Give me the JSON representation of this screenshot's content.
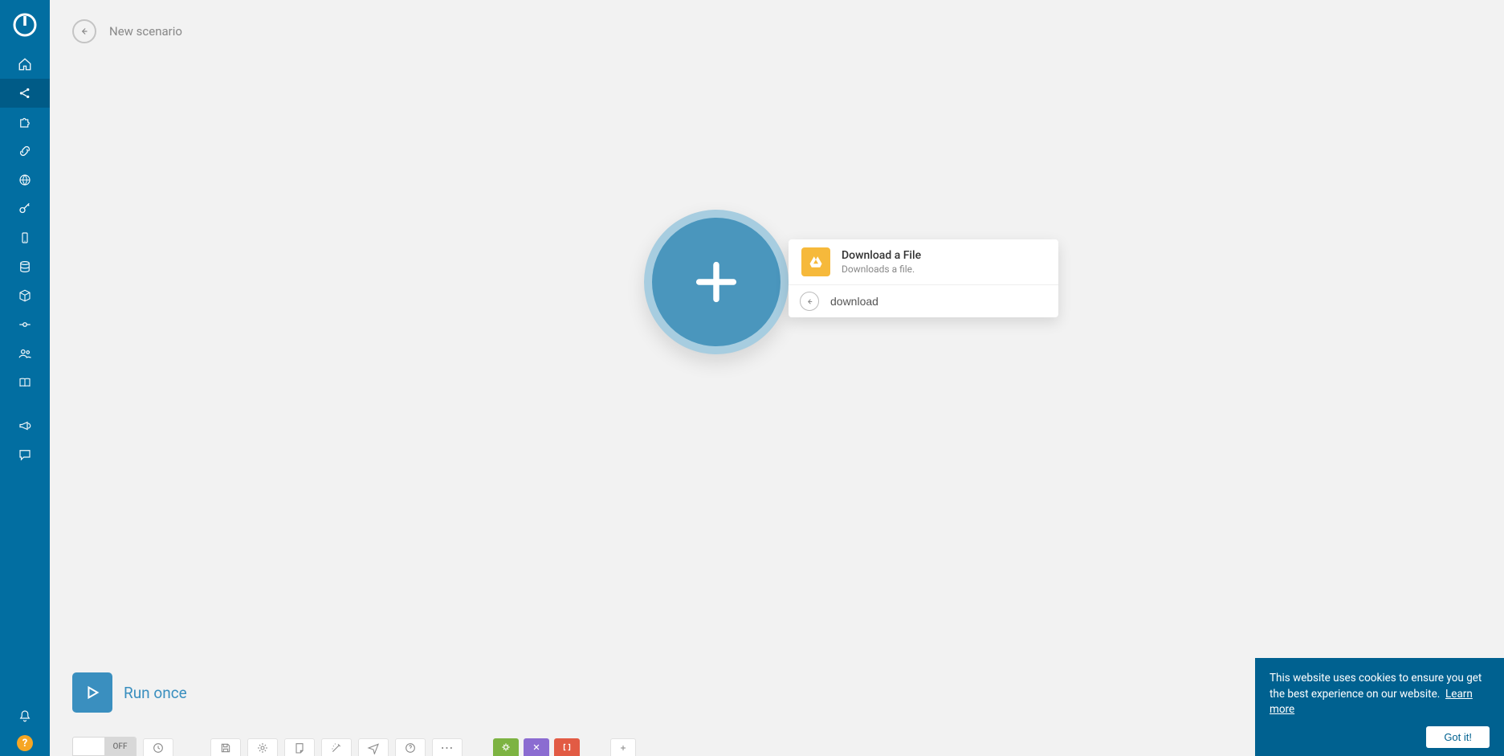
{
  "header": {
    "title": "New scenario"
  },
  "sidebar": {
    "items": [
      {
        "name": "home",
        "active": false
      },
      {
        "name": "share",
        "active": true
      },
      {
        "name": "puzzle",
        "active": false
      },
      {
        "name": "link",
        "active": false
      },
      {
        "name": "globe",
        "active": false
      },
      {
        "name": "key",
        "active": false
      },
      {
        "name": "mobile",
        "active": false
      },
      {
        "name": "database",
        "active": false
      },
      {
        "name": "cube",
        "active": false
      },
      {
        "name": "node",
        "active": false
      },
      {
        "name": "users",
        "active": false
      },
      {
        "name": "book",
        "active": false
      },
      {
        "name": "megaphone",
        "active": false
      },
      {
        "name": "chat",
        "active": false
      }
    ],
    "bottom": {
      "bell": "notifications",
      "help": "?"
    }
  },
  "dropdown": {
    "item": {
      "title": "Download a File",
      "subtitle": "Downloads a file.",
      "icon": "google-drive"
    },
    "search_value": "download"
  },
  "run": {
    "label": "Run once"
  },
  "bottombar": {
    "toggle_label": "OFF",
    "tools": [
      "clock",
      "save",
      "settings",
      "note",
      "wand",
      "plane",
      "help",
      "more"
    ],
    "favorites": [
      "green",
      "purple",
      "red"
    ]
  },
  "cookie": {
    "text": "This website uses cookies to ensure you get the best experience on our website.",
    "learn_more": "Learn more",
    "button": "Got it!"
  }
}
